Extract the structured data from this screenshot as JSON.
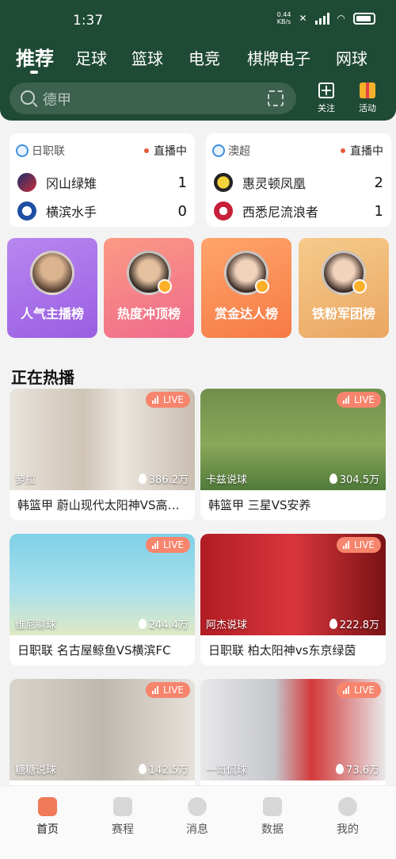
{
  "status": {
    "time": "1:37",
    "speed": "0.44",
    "speed_unit": "KB/s",
    "battery_icon": "battery-icon"
  },
  "categories": [
    "推荐",
    "足球",
    "篮球",
    "电竞",
    "棋牌电子",
    "网球"
  ],
  "search": {
    "placeholder": "德甲"
  },
  "header_actions": {
    "follow": "关注",
    "activity": "活动"
  },
  "matches": [
    {
      "league": "日职联",
      "status": "直播中",
      "home": {
        "name": "冈山绿雉",
        "score": "1"
      },
      "away": {
        "name": "横滨水手",
        "score": "0"
      }
    },
    {
      "league": "澳超",
      "status": "直播中",
      "home": {
        "name": "惠灵顿凤凰",
        "score": "2"
      },
      "away": {
        "name": "西悉尼流浪者",
        "score": "1"
      }
    }
  ],
  "ranks": [
    "人气主播榜",
    "热度冲顶榜",
    "赏金达人榜",
    "铁粉军团榜"
  ],
  "section": {
    "title": "正在热播"
  },
  "live_badge": "LIVE",
  "streams": [
    {
      "host": "萝拉",
      "views": "386.2万",
      "title": "韩篮甲 蔚山现代太阳神VS高阳索诺天空"
    },
    {
      "host": "卡兹说球",
      "views": "304.5万",
      "title": "韩篮甲 三星VS安养"
    },
    {
      "host": "维尼聊球",
      "views": "244.4万",
      "title": "日职联 名古屋鲸鱼VS横滨FC"
    },
    {
      "host": "阿杰说球",
      "views": "222.8万",
      "title": "日职联 柏太阳神vs东京绿茵"
    },
    {
      "host": "糖糖说球",
      "views": "142.5万",
      "title": ""
    },
    {
      "host": "一哥侃球",
      "views": "73.6万",
      "title": ""
    }
  ],
  "nav": [
    "首页",
    "赛程",
    "消息",
    "数据",
    "我的"
  ],
  "colors": {
    "header": "#1f4a35",
    "accent": "#f07a5a",
    "live_badge": "#f7846c"
  }
}
